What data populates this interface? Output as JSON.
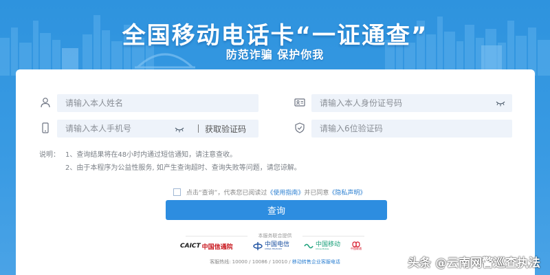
{
  "banner": {
    "title": "全国移动电话卡“一证通查”",
    "subtitle": "防范诈骗 保护你我"
  },
  "form": {
    "name_placeholder": "请输入本人姓名",
    "id_placeholder": "请输入本人身份证号码",
    "phone_placeholder": "请输入本人手机号",
    "get_code_label": "获取验证码",
    "code_placeholder": "请输入6位验证码"
  },
  "notes": {
    "label": "说明：",
    "line1": "1、查询结果将在48小时内通过短信通知，请注意查收。",
    "line2": "2、由于本程序为公益性服务, 如产生查询超时、查询失败等问题，请您谅解。"
  },
  "agreement": {
    "prefix": "点击“查询”，代表您已阅读过",
    "terms_link": "《使用指南》",
    "middle": "并已同意",
    "privacy_link": "《隐私声明》"
  },
  "submit_label": "查询",
  "footer": {
    "provided_by": "本服务联合提供",
    "caict_mark": "CAICT",
    "caict_name": "中国信通院",
    "telecom_name": "中国电信",
    "telecom_en": "CHINA TELECOM",
    "mobile_name": "中国移动",
    "mobile_en": "China Mobile",
    "unicom_name": "中国联通",
    "hotline_text": "客服热线: 10000 / 10086 / 10010 /",
    "hotline_link": "移动转售企业客服电话"
  },
  "watermark": "头条 @云南网警巡查执法",
  "colors": {
    "banner_blue": "#2e93de",
    "button_blue": "#2d8de0",
    "link_blue": "#2b7fd1",
    "field_bg": "#eef3fa",
    "caict_red": "#c8161d",
    "telecom_blue": "#1a4fa0",
    "mobile_teal": "#1aa07a",
    "unicom_red": "#d7182a"
  }
}
